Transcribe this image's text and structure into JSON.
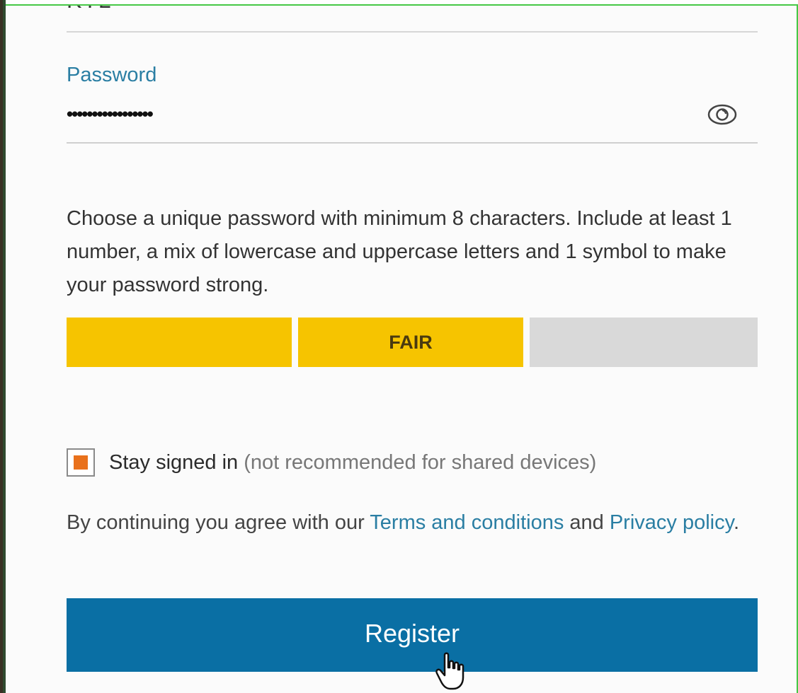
{
  "previous_field": {
    "value_partial": "KYL"
  },
  "password_field": {
    "label": "Password",
    "masked_value": "•••••••••••••••••",
    "toggle_icon": "eye-icon"
  },
  "hint_text": "Choose a unique password with minimum 8 characters. Include at least 1 number, a mix of lowercase and uppercase letters and 1 symbol to make your password strong.",
  "strength_meter": {
    "label": "FAIR",
    "filled_segments": 2,
    "total_segments": 3,
    "fill_color": "#f6c400",
    "empty_color": "#d9d9d9"
  },
  "stay_signed_in": {
    "checked": true,
    "label": "Stay signed in",
    "note": "(not recommended for shared devices)",
    "check_color": "#e9711c"
  },
  "agreement": {
    "prefix": "By continuing you agree with our ",
    "terms_link": "Terms and conditions",
    "middle": " and ",
    "privacy_link": "Privacy policy",
    "suffix": "."
  },
  "register_button": {
    "label": "Register",
    "color": "#0a6fa4"
  },
  "colors": {
    "link": "#2a7ea3",
    "text": "#333333"
  }
}
